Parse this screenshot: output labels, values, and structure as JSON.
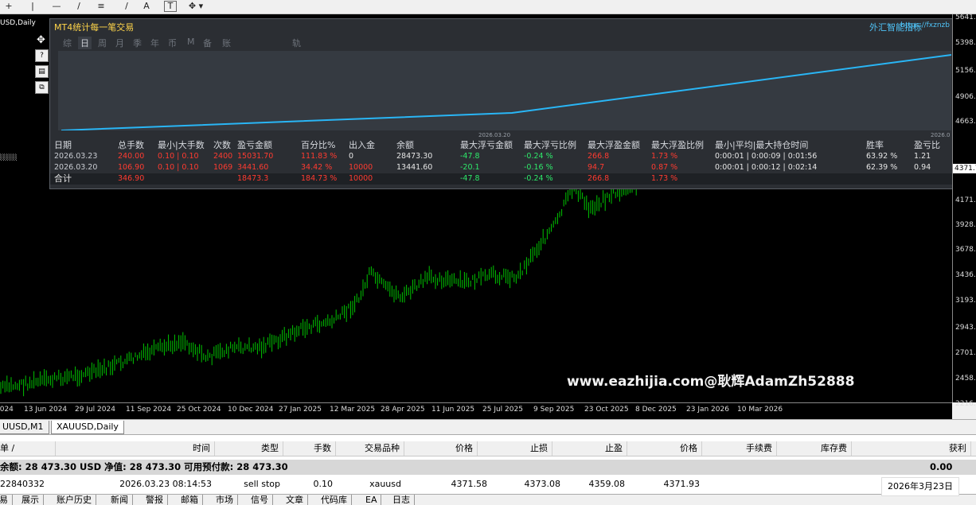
{
  "toolbar": {
    "items": [
      "+",
      "|",
      "—",
      "/",
      "≡",
      "/",
      "A",
      "T",
      "✥"
    ]
  },
  "chart": {
    "symbol_label": "USD,Daily",
    "price_labels": [
      "5641.3",
      "5398.8",
      "5156.3",
      "4906.3",
      "4663.8",
      "4371.7",
      "4171.3",
      "3928.8",
      "3678.8",
      "3436.3",
      "3193.8",
      "2943.8",
      "2701.3",
      "2458.8",
      "2216.3"
    ],
    "current_price": "4371.7",
    "time_labels": [
      "2024",
      "13 Jun 2024",
      "29 Jul 2024",
      "11 Sep 2024",
      "25 Oct 2024",
      "10 Dec 2024",
      "27 Jan 2025",
      "12 Mar 2025",
      "28 Apr 2025",
      "11 Jun 2025",
      "25 Jul 2025",
      "9 Sep 2025",
      "23 Oct 2025",
      "8 Dec 2025",
      "23 Jan 2026",
      "10 Mar 2026"
    ],
    "watermark": "www.eazhijia.com@耿辉AdamZh52888",
    "candle_color": "#00c400"
  },
  "vtools": [
    "✥",
    "?",
    "📊",
    "⊞"
  ],
  "panel": {
    "title": "MT4统计每一笔交易",
    "brand": "外汇智能指标",
    "url": "https://fxznzb",
    "tabs": [
      "综",
      "日",
      "周",
      "月",
      "季",
      "年",
      "币",
      "M",
      "备",
      "账户",
      "轨迹"
    ],
    "active_tab": "日",
    "curve_dates": [
      "2026.03.20",
      "2026.0"
    ],
    "curve_color": "#29b6f6",
    "headers": [
      "日期",
      "总手数",
      "最小|大手数",
      "次数",
      "盈亏金额",
      "百分比%",
      "出入金",
      "余额",
      "最大浮亏金额",
      "最大浮亏比例",
      "最大浮盈金额",
      "最大浮盈比例",
      "最小|平均|最大持仓时间",
      "胜率",
      "盈亏比"
    ],
    "rows": [
      [
        "2026.03.23",
        "240.00",
        "0.10 | 0.10",
        "2400",
        "15031.70",
        "111.83 %",
        "0",
        "28473.30",
        "-47.8",
        "-0.24 %",
        "266.8",
        "1.73 %",
        "0:00:01 | 0:00:09 | 0:01:56",
        "63.92 %",
        "1.21"
      ],
      [
        "2026.03.20",
        "106.90",
        "0.10 | 0.10",
        "1069",
        "3441.60",
        "34.42 %",
        "10000",
        "13441.60",
        "-20.1",
        "-0.16 %",
        "94.7",
        "0.87 %",
        "0:00:01 | 0:00:12 | 0:02:14",
        "62.39 %",
        "0.94"
      ]
    ],
    "sum_row": {
      "label": "合计",
      "lots": "346.90",
      "pnl": "18473.3",
      "pct": "184.73 %",
      "io": "10000",
      "max_dd": "-47.8",
      "max_dd_pct": "-0.24 %",
      "max_fp": "266.8",
      "max_fp_pct": "1.73 %"
    }
  },
  "chart_tabs": [
    "UUSD,M1",
    "XAUUSD,Daily"
  ],
  "active_chart_tab": "XAUUSD,Daily",
  "terminal": {
    "headers": [
      "单 /",
      "时间",
      "类型",
      "手数",
      "交易品种",
      "价格",
      "止损",
      "止盈",
      "价格",
      "手续费",
      "库存费",
      "获利"
    ],
    "balance_line": "余额: 28 473.30 USD  净值: 28 473.30  可用预付款: 28 473.30",
    "balance_profit": "0.00",
    "order": {
      "ticket": "22840332",
      "time": "2026.03.23 08:14:53",
      "type": "sell stop",
      "lots": "0.10",
      "symbol": "xauusd",
      "price": "4371.58",
      "sl": "4373.08",
      "tp": "4359.08",
      "cur_price": "4371.93"
    },
    "bottom_tabs": [
      "易",
      "展示",
      "账户历史",
      "新闻",
      "警报",
      "邮箱",
      "市场",
      "信号",
      "文章",
      "代码库",
      "EA",
      "日志"
    ],
    "date_badge": "2026年3月23日"
  }
}
